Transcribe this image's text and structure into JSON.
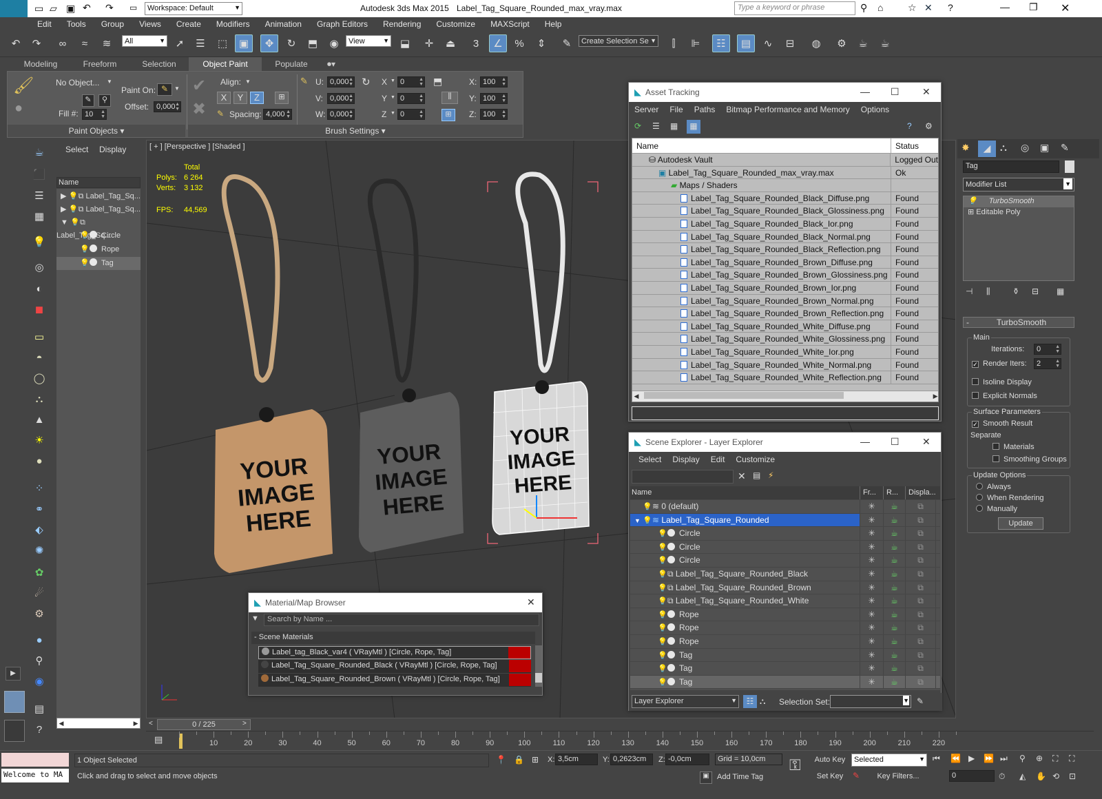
{
  "titlebar": {
    "workspace": "Workspace: Default",
    "app_title": "Autodesk 3ds Max  2015",
    "file_title": "Label_Tag_Square_Rounded_max_vray.max",
    "search_placeholder": "Type a keyword or phrase"
  },
  "menu": [
    "Edit",
    "Tools",
    "Group",
    "Views",
    "Create",
    "Modifiers",
    "Animation",
    "Graph Editors",
    "Rendering",
    "Customize",
    "MAXScript",
    "Help"
  ],
  "maintoolbar": {
    "filter": "All",
    "refcoord": "View",
    "selection_set": "Create Selection Se"
  },
  "ribbon": {
    "tabs": [
      "Modeling",
      "Freeform",
      "Selection",
      "Object Paint",
      "Populate"
    ],
    "active_tab": "Object Paint",
    "no_object": "No Object...",
    "paint_on": "Paint On:",
    "offset": "Offset:",
    "offset_val": "0,000",
    "fill": "Fill #:",
    "fill_val": "10",
    "align": "Align:",
    "spacing": "Spacing:",
    "spacing_val": "4,000",
    "u": "U:",
    "v": "V:",
    "w": "W:",
    "uvw_val": "0,000",
    "x": "X",
    "y": "Y",
    "z": "Z",
    "xyz_val": "0",
    "scale_x": "X:",
    "scale_y": "Y:",
    "scale_z": "Z:",
    "scale_val": "100",
    "paint_objects": "Paint Objects",
    "brush_settings": "Brush Settings"
  },
  "scene_side": {
    "tabs": [
      "Select",
      "Display"
    ],
    "header": "Name",
    "items": [
      "Label_Tag_Sq...",
      "Label_Tag_Sq...",
      "Label_Tag_Sq...",
      "Circle",
      "Rope",
      "Tag"
    ]
  },
  "viewport": {
    "label": "[ + ] [Perspective ] [Shaded ]",
    "stats": {
      "total": "Total",
      "polys_label": "Polys:",
      "polys": "6 264",
      "verts_label": "Verts:",
      "verts": "3 132",
      "fps_label": "FPS:",
      "fps": "44,569"
    },
    "tag_text": [
      "YOUR",
      "IMAGE",
      "HERE"
    ]
  },
  "asset_tracking": {
    "title": "Asset Tracking",
    "menu": [
      "Server",
      "File",
      "Paths",
      "Bitmap Performance and Memory",
      "Options"
    ],
    "columns": [
      "Name",
      "Status"
    ],
    "rows": [
      {
        "name": "Autodesk Vault",
        "status": "Logged Out"
      },
      {
        "name": "Label_Tag_Square_Rounded_max_vray.max",
        "status": "Ok"
      },
      {
        "name": "Maps / Shaders",
        "status": ""
      },
      {
        "name": "Label_Tag_Square_Rounded_Black_Diffuse.png",
        "status": "Found"
      },
      {
        "name": "Label_Tag_Square_Rounded_Black_Glossiness.png",
        "status": "Found"
      },
      {
        "name": "Label_Tag_Square_Rounded_Black_Ior.png",
        "status": "Found"
      },
      {
        "name": "Label_Tag_Square_Rounded_Black_Normal.png",
        "status": "Found"
      },
      {
        "name": "Label_Tag_Square_Rounded_Black_Reflection.png",
        "status": "Found"
      },
      {
        "name": "Label_Tag_Square_Rounded_Brown_Diffuse.png",
        "status": "Found"
      },
      {
        "name": "Label_Tag_Square_Rounded_Brown_Glossiness.png",
        "status": "Found"
      },
      {
        "name": "Label_Tag_Square_Rounded_Brown_Ior.png",
        "status": "Found"
      },
      {
        "name": "Label_Tag_Square_Rounded_Brown_Normal.png",
        "status": "Found"
      },
      {
        "name": "Label_Tag_Square_Rounded_Brown_Reflection.png",
        "status": "Found"
      },
      {
        "name": "Label_Tag_Square_Rounded_White_Diffuse.png",
        "status": "Found"
      },
      {
        "name": "Label_Tag_Square_Rounded_White_Glossiness.png",
        "status": "Found"
      },
      {
        "name": "Label_Tag_Square_Rounded_White_Ior.png",
        "status": "Found"
      },
      {
        "name": "Label_Tag_Square_Rounded_White_Normal.png",
        "status": "Found"
      },
      {
        "name": "Label_Tag_Square_Rounded_White_Reflection.png",
        "status": "Found"
      }
    ]
  },
  "scene_explorer": {
    "title": "Scene Explorer - Layer Explorer",
    "menu": [
      "Select",
      "Display",
      "Edit",
      "Customize"
    ],
    "columns": [
      "Name",
      "Fr...",
      "R...",
      "Displa..."
    ],
    "rows": [
      "0 (default)",
      "Label_Tag_Square_Rounded",
      "Circle",
      "Circle",
      "Circle",
      "Label_Tag_Square_Rounded_Black",
      "Label_Tag_Square_Rounded_Brown",
      "Label_Tag_Square_Rounded_White",
      "Rope",
      "Rope",
      "Rope",
      "Tag",
      "Tag",
      "Tag"
    ],
    "footer_mode": "Layer Explorer",
    "selection_set": "Selection Set:"
  },
  "material_browser": {
    "title": "Material/Map Browser",
    "search_placeholder": "Search by Name ...",
    "group": "- Scene Materials",
    "items": [
      "Label_tag_Black_var4  ( VRayMtl )  [Circle, Rope, Tag]",
      "Label_Tag_Square_Rounded_Black  ( VRayMtl )  [Circle, Rope, Tag]",
      "Label_Tag_Square_Rounded_Brown  ( VRayMtl )  [Circle, Rope, Tag]"
    ]
  },
  "command_panel": {
    "object_name": "Tag",
    "modifier_list": "Modifier List",
    "stack": [
      "TurboSmooth",
      "Editable Poly"
    ],
    "rollout": "TurboSmooth",
    "main": "Main",
    "iterations_label": "Iterations:",
    "iterations": "0",
    "render_iters_label": "Render Iters:",
    "render_iters": "2",
    "isoline": "Isoline Display",
    "explicit": "Explicit Normals",
    "surface_params": "Surface Parameters",
    "smooth_result": "Smooth Result",
    "separate": "Separate",
    "materials": "Materials",
    "smoothing_groups": "Smoothing Groups",
    "update_options": "Update Options",
    "always": "Always",
    "when_rendering": "When Rendering",
    "manually": "Manually",
    "update": "Update"
  },
  "timeline": {
    "frame": "0 / 225",
    "ticks": [
      "10",
      "20",
      "30",
      "40",
      "50",
      "60",
      "70",
      "80",
      "90",
      "100",
      "110",
      "120",
      "130",
      "140",
      "150",
      "160",
      "170",
      "180",
      "190",
      "200",
      "210",
      "220"
    ]
  },
  "status": {
    "maxscript": "Welcome to MA",
    "selected": "1 Object Selected",
    "prompt": "Click and drag to select and move objects",
    "x_label": "X:",
    "x": "3,5cm",
    "y_label": "Y:",
    "y": "0,2623cm",
    "z_label": "Z:",
    "z": "-0,0cm",
    "grid": "Grid = 10,0cm",
    "auto_key": "Auto Key",
    "set_key": "Set Key",
    "key_mode": "Selected",
    "key_filters": "Key Filters...",
    "add_time_tag": "Add Time Tag",
    "frame_field": "0"
  }
}
